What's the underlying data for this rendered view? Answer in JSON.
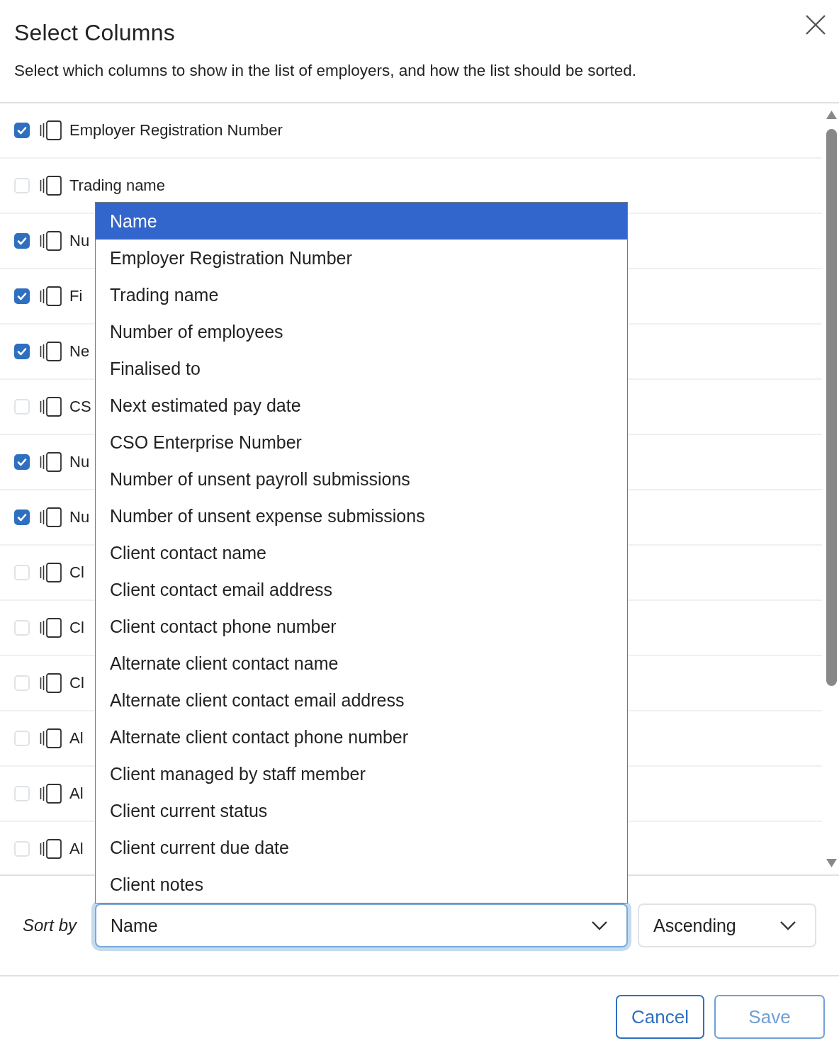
{
  "dialog": {
    "title": "Select Columns",
    "description": "Select which columns to show in the list of employers, and how the list should be sorted."
  },
  "columns": [
    {
      "label": "Employer Registration Number",
      "checked": true
    },
    {
      "label": "Trading name",
      "checked": false
    },
    {
      "label": "Nu",
      "checked": true
    },
    {
      "label": "Fi",
      "checked": true
    },
    {
      "label": "Ne",
      "checked": true
    },
    {
      "label": "CS",
      "checked": false
    },
    {
      "label": "Nu",
      "checked": true
    },
    {
      "label": "Nu",
      "checked": true
    },
    {
      "label": "Cl",
      "checked": false
    },
    {
      "label": "Cl",
      "checked": false
    },
    {
      "label": "Cl",
      "checked": false
    },
    {
      "label": "Al",
      "checked": false
    },
    {
      "label": "Al",
      "checked": false
    },
    {
      "label": "Al",
      "checked": false
    }
  ],
  "sort": {
    "label": "Sort by",
    "field": {
      "value": "Name",
      "expanded": true
    },
    "options": [
      {
        "label": "Name",
        "selected": true
      },
      {
        "label": "Employer Registration Number",
        "selected": false
      },
      {
        "label": "Trading name",
        "selected": false
      },
      {
        "label": "Number of employees",
        "selected": false
      },
      {
        "label": "Finalised to",
        "selected": false
      },
      {
        "label": "Next estimated pay date",
        "selected": false
      },
      {
        "label": "CSO Enterprise Number",
        "selected": false
      },
      {
        "label": "Number of unsent payroll submissions",
        "selected": false
      },
      {
        "label": "Number of unsent expense submissions",
        "selected": false
      },
      {
        "label": "Client contact name",
        "selected": false
      },
      {
        "label": "Client contact email address",
        "selected": false
      },
      {
        "label": "Client contact phone number",
        "selected": false
      },
      {
        "label": "Alternate client contact name",
        "selected": false
      },
      {
        "label": "Alternate client contact email address",
        "selected": false
      },
      {
        "label": "Alternate client contact phone number",
        "selected": false
      },
      {
        "label": "Client managed by staff member",
        "selected": false
      },
      {
        "label": "Client current status",
        "selected": false
      },
      {
        "label": "Client current due date",
        "selected": false
      },
      {
        "label": "Client notes",
        "selected": false
      }
    ],
    "order": {
      "value": "Ascending"
    }
  },
  "buttons": [
    {
      "label": "Cancel",
      "disabled": false
    },
    {
      "label": "Save",
      "disabled": true
    }
  ]
}
